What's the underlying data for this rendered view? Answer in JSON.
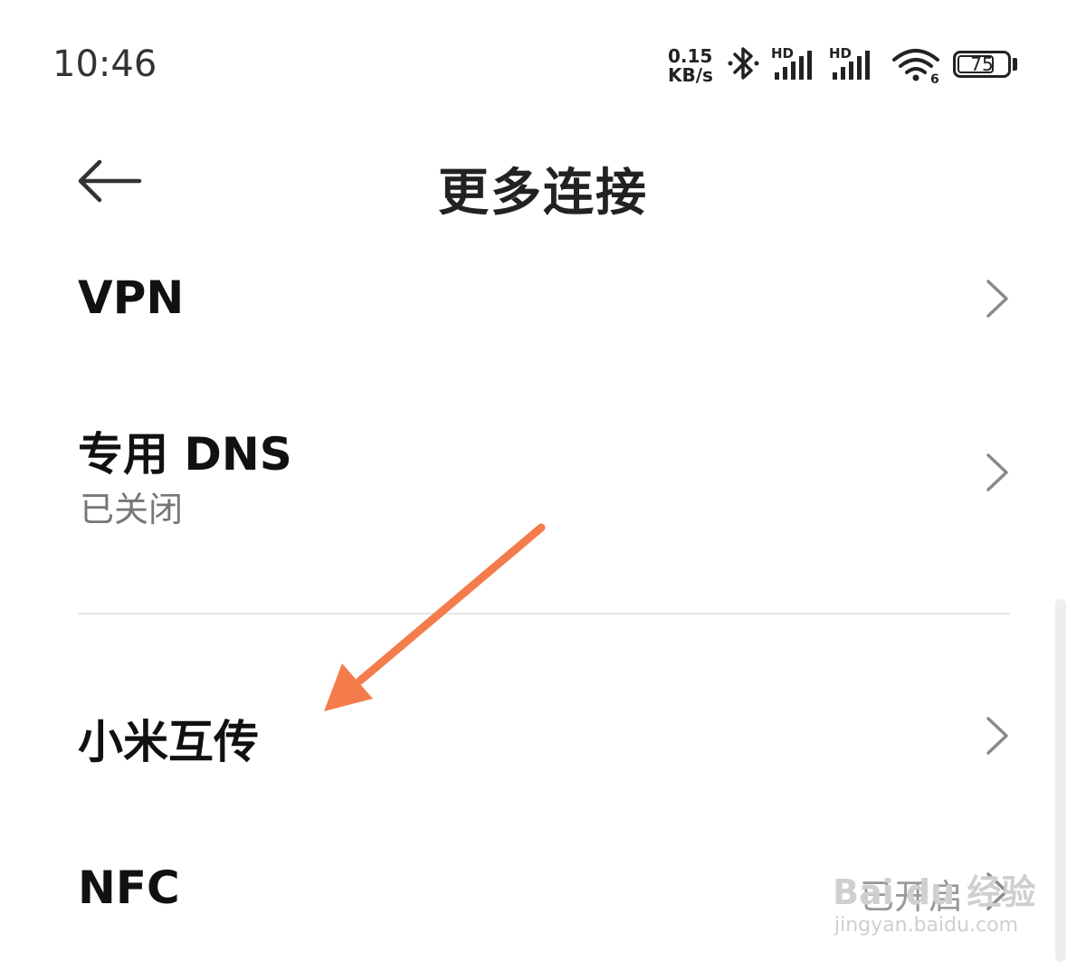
{
  "status_bar": {
    "time": "10:46",
    "network_speed_value": "0.15",
    "network_speed_unit": "KB/s",
    "signal_1_label": "HD",
    "signal_2_label": "HD",
    "wifi_label": "6",
    "battery_level": 75,
    "battery_text": "75",
    "icons": [
      "bluetooth-icon",
      "signal-icon",
      "signal-icon",
      "wifi-icon",
      "battery-icon"
    ]
  },
  "header": {
    "title": "更多连接",
    "back_icon": "arrow-left-icon"
  },
  "list": {
    "items": [
      {
        "title": "VPN",
        "subtitle": "",
        "value": ""
      },
      {
        "title": "专用 DNS",
        "subtitle": "已关闭",
        "value": ""
      },
      {
        "title": "小米互传",
        "subtitle": "",
        "value": ""
      },
      {
        "title": "NFC",
        "subtitle": "",
        "value": "已开启"
      }
    ]
  },
  "watermark": {
    "text": "Bai du 经验",
    "url": "jingyan.baidu.com"
  },
  "colors": {
    "background": "#ffffff",
    "text_primary": "#111111",
    "text_secondary": "#777777",
    "annotation_arrow": "#f47c4c",
    "divider": "#e6e6e6"
  }
}
